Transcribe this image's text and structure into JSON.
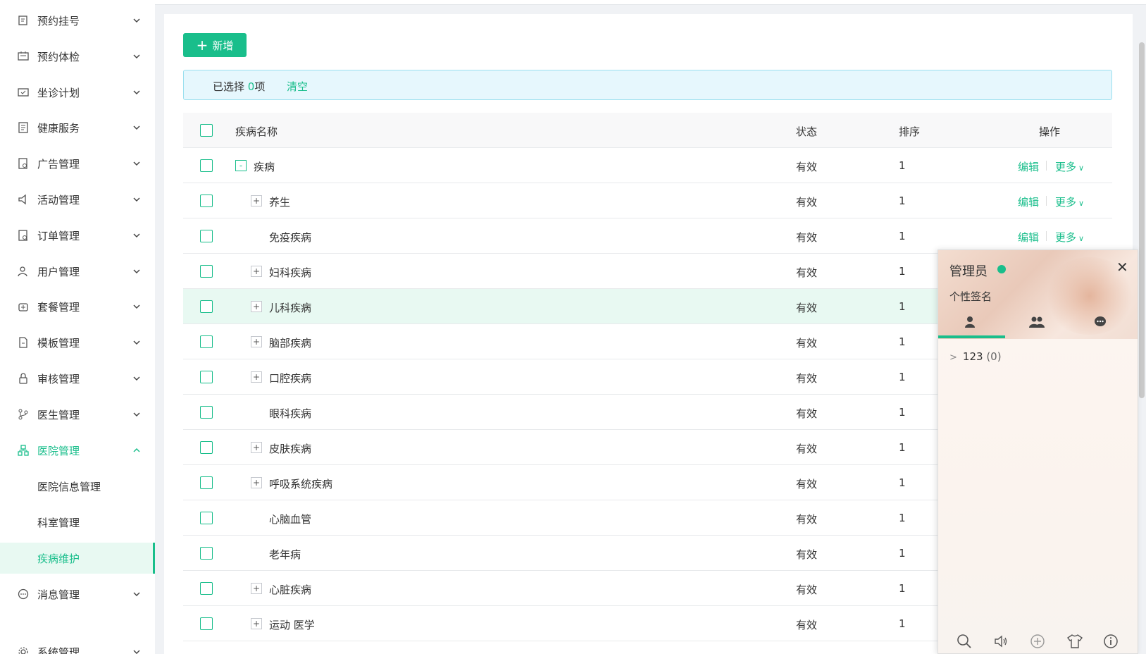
{
  "sidebar": {
    "items": [
      {
        "label": "预约挂号",
        "icon": "calendar-icon"
      },
      {
        "label": "预约体检",
        "icon": "checklist-icon"
      },
      {
        "label": "坐诊计划",
        "icon": "schedule-icon"
      },
      {
        "label": "健康服务",
        "icon": "document-icon"
      },
      {
        "label": "广告管理",
        "icon": "ad-icon"
      },
      {
        "label": "活动管理",
        "icon": "megaphone-icon"
      },
      {
        "label": "订单管理",
        "icon": "order-icon"
      },
      {
        "label": "用户管理",
        "icon": "user-icon"
      },
      {
        "label": "套餐管理",
        "icon": "package-icon"
      },
      {
        "label": "模板管理",
        "icon": "template-icon"
      },
      {
        "label": "审核管理",
        "icon": "lock-icon"
      },
      {
        "label": "医生管理",
        "icon": "branch-icon"
      },
      {
        "label": "医院管理",
        "icon": "hospital-icon"
      }
    ],
    "sub_items": [
      "医院信息管理",
      "科室管理",
      "疾病维护"
    ],
    "after_items": [
      {
        "label": "消息管理",
        "icon": "message-icon"
      },
      {
        "label": "系统管理",
        "icon": "settings-icon"
      }
    ]
  },
  "toolbar": {
    "add_label": "新增"
  },
  "selection": {
    "prefix": "已选择 ",
    "count": "0",
    "suffix": "项",
    "clear_label": "清空"
  },
  "table": {
    "headers": {
      "name": "疾病名称",
      "status": "状态",
      "sort": "排序",
      "ops": "操作"
    },
    "edit_label": "编辑",
    "more_label": "更多",
    "rows": [
      {
        "name": "疾病",
        "status": "有效",
        "sort": "1",
        "expander": "-"
      },
      {
        "name": "养生",
        "status": "有效",
        "sort": "1",
        "expander": "+"
      },
      {
        "name": "免疫疾病",
        "status": "有效",
        "sort": "1",
        "expander": ""
      },
      {
        "name": "妇科疾病",
        "status": "有效",
        "sort": "1",
        "expander": "+"
      },
      {
        "name": "儿科疾病",
        "status": "有效",
        "sort": "1",
        "expander": "+"
      },
      {
        "name": "脑部疾病",
        "status": "有效",
        "sort": "1",
        "expander": "+"
      },
      {
        "name": "口腔疾病",
        "status": "有效",
        "sort": "1",
        "expander": "+"
      },
      {
        "name": "眼科疾病",
        "status": "有效",
        "sort": "1",
        "expander": ""
      },
      {
        "name": "皮肤疾病",
        "status": "有效",
        "sort": "1",
        "expander": "+"
      },
      {
        "name": "呼吸系统疾病",
        "status": "有效",
        "sort": "1",
        "expander": "+"
      },
      {
        "name": "心脑血管",
        "status": "有效",
        "sort": "1",
        "expander": ""
      },
      {
        "name": "老年病",
        "status": "有效",
        "sort": "1",
        "expander": ""
      },
      {
        "name": "心脏疾病",
        "status": "有效",
        "sort": "1",
        "expander": "+"
      },
      {
        "name": "运动 医学",
        "status": "有效",
        "sort": "1",
        "expander": "+"
      }
    ]
  },
  "chat": {
    "title": "管理员",
    "signature": "个性签名",
    "group_name": "123",
    "group_count": "(0)"
  },
  "colors": {
    "accent": "#19be8b",
    "alert_bg": "#e6f7fd"
  }
}
